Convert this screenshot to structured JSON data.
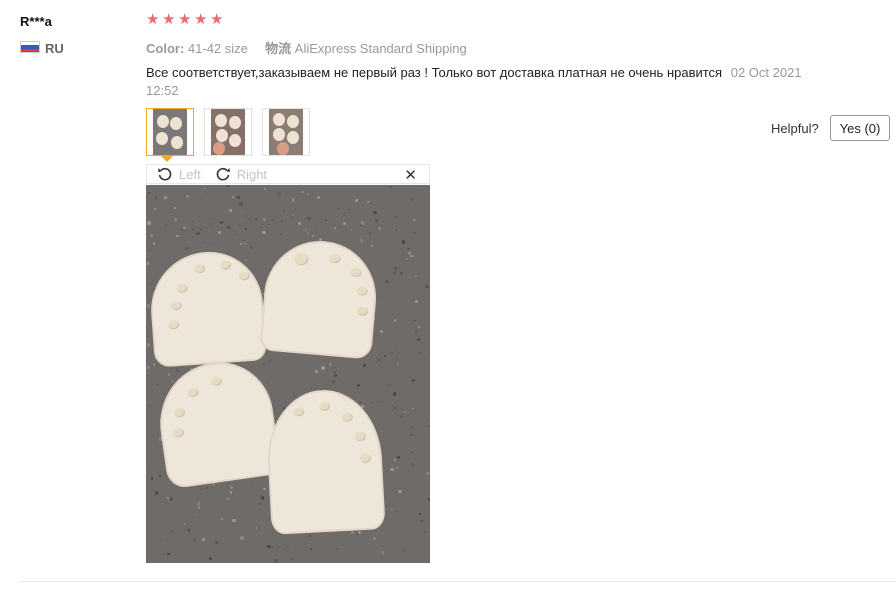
{
  "review": {
    "user_name": "R***a",
    "country_code": "RU",
    "rating": 5,
    "attrs": {
      "color_label": "Color:",
      "color_value": "41-42 size",
      "shipping_label": "物流",
      "shipping_value": "AliExpress Standard Shipping"
    },
    "text": "Все соответствует,заказываем не первый раз ! Только вот доставка платная не очень нравится",
    "date": "02 Oct 2021 12:52",
    "viewer": {
      "rotate_left": "Left",
      "rotate_right": "Right",
      "close": "✕"
    },
    "helpful": {
      "label": "Helpful?",
      "yes_button": "Yes (0)"
    }
  },
  "icons": {
    "star": "★",
    "rotate_left": "rotate-left-icon",
    "rotate_right": "rotate-right-icon",
    "close": "close-icon"
  },
  "colors": {
    "star": "#f56a6a",
    "active_thumb_border": "#f5a623"
  }
}
